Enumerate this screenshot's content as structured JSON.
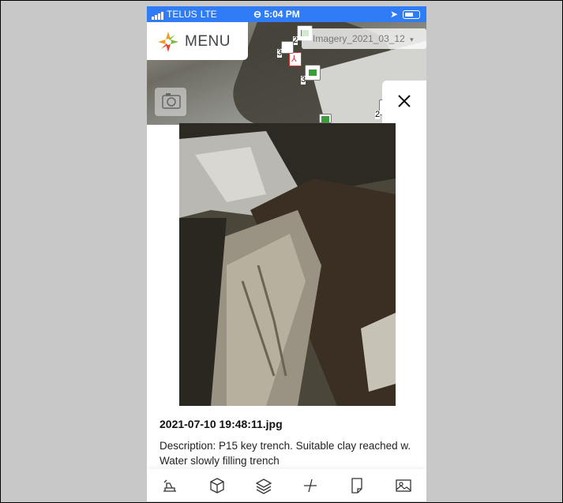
{
  "status_bar": {
    "carrier": "TELUS",
    "network": "LTE",
    "time": "5:04 PM"
  },
  "map": {
    "menu_label": "MENU",
    "layer_selector": "Imagery_2021_03_12",
    "cluster_counts": [
      "2",
      "3",
      "3",
      "2"
    ]
  },
  "photo_modal": {
    "filename": "2021-07-10 19:48:11.jpg",
    "description": "Description: P15 key trench. Suitable clay reached w. Water slowly filling trench"
  },
  "toolbar": {
    "tools": [
      {
        "icon": "excavator-icon"
      },
      {
        "icon": "box-3d-icon"
      },
      {
        "icon": "layers-icon"
      },
      {
        "icon": "measure-icon"
      },
      {
        "icon": "document-icon"
      },
      {
        "icon": "image-icon"
      }
    ]
  },
  "colors": {
    "status_bar": "#2f7cf6",
    "logo_orange": "#f29a1f",
    "logo_green": "#7dbb3d",
    "logo_red": "#e4482c"
  }
}
